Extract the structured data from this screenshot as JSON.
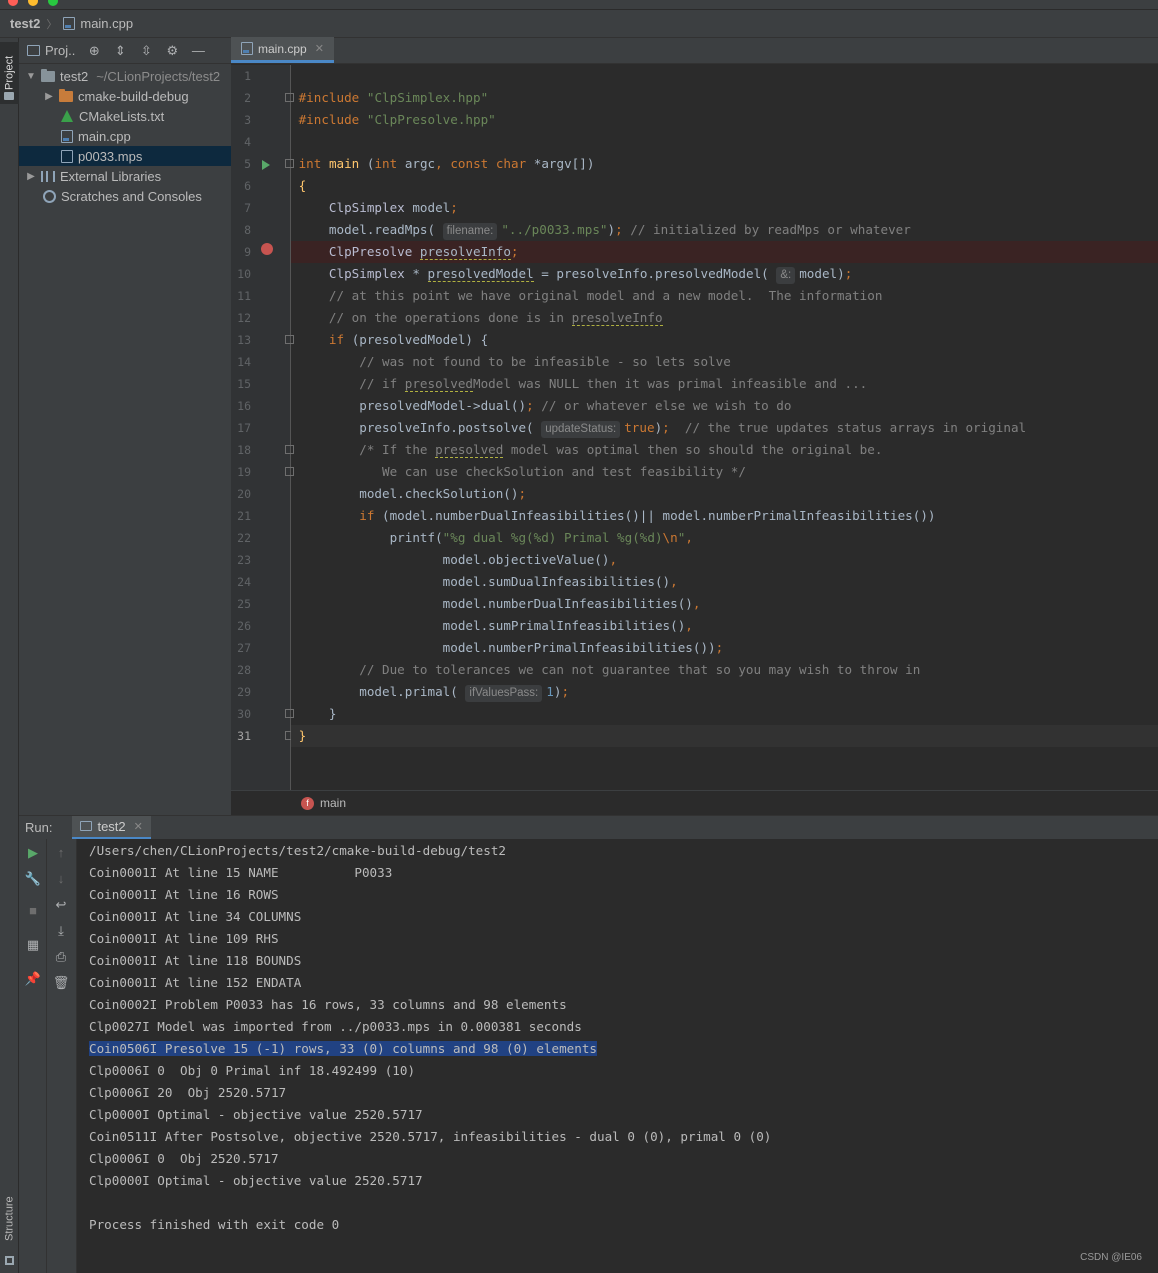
{
  "navbar": {
    "project": "test2",
    "file": "main.cpp"
  },
  "left_strip": {
    "project_tab": "Project",
    "structure_tab": "Structure"
  },
  "project_panel": {
    "title": "Proj..",
    "tree": [
      {
        "label": "test2",
        "sub": "~/CLionProjects/test2"
      },
      {
        "label": "cmake-build-debug"
      },
      {
        "label": "CMakeLists.txt"
      },
      {
        "label": "main.cpp"
      },
      {
        "label": "p0033.mps"
      },
      {
        "label": "External Libraries"
      },
      {
        "label": "Scratches and Consoles"
      }
    ]
  },
  "editor": {
    "tab": "main.cpp",
    "hints": {
      "filename": "filename:",
      "amp": "&:",
      "update_status": "updateStatus:",
      "if_values_pass": "ifValuesPass:"
    },
    "breadcrumb": "main",
    "line_numbers": [
      "1",
      "2",
      "3",
      "4",
      "5",
      "6",
      "7",
      "8",
      "9",
      "10",
      "11",
      "12",
      "13",
      "14",
      "15",
      "16",
      "17",
      "18",
      "19",
      "20",
      "21",
      "22",
      "23",
      "24",
      "25",
      "26",
      "27",
      "28",
      "29",
      "30",
      "31"
    ]
  },
  "run": {
    "label": "Run:",
    "tab": "test2",
    "output": [
      "/Users/chen/CLionProjects/test2/cmake-build-debug/test2",
      "Coin0001I At line 15 NAME          P0033",
      "Coin0001I At line 16 ROWS",
      "Coin0001I At line 34 COLUMNS",
      "Coin0001I At line 109 RHS",
      "Coin0001I At line 118 BOUNDS",
      "Coin0001I At line 152 ENDATA",
      "Coin0002I Problem P0033 has 16 rows, 33 columns and 98 elements",
      "Clp0027I Model was imported from ../p0033.mps in 0.000381 seconds",
      "Coin0506I Presolve 15 (-1) rows, 33 (0) columns and 98 (0) elements",
      "Clp0006I 0  Obj 0 Primal inf 18.492499 (10)",
      "Clp0006I 20  Obj 2520.5717",
      "Clp0000I Optimal - objective value 2520.5717",
      "Coin0511I After Postsolve, objective 2520.5717, infeasibilities - dual 0 (0), primal 0 (0)",
      "Clp0006I 0  Obj 2520.5717",
      "Clp0000I Optimal - objective value 2520.5717",
      "",
      "Process finished with exit code 0"
    ]
  },
  "watermark": "CSDN @IE06",
  "colors": {
    "accent": "#4a88c7",
    "selection": "#214283",
    "breakpoint": "#c75450",
    "run_green": "#59a869"
  }
}
